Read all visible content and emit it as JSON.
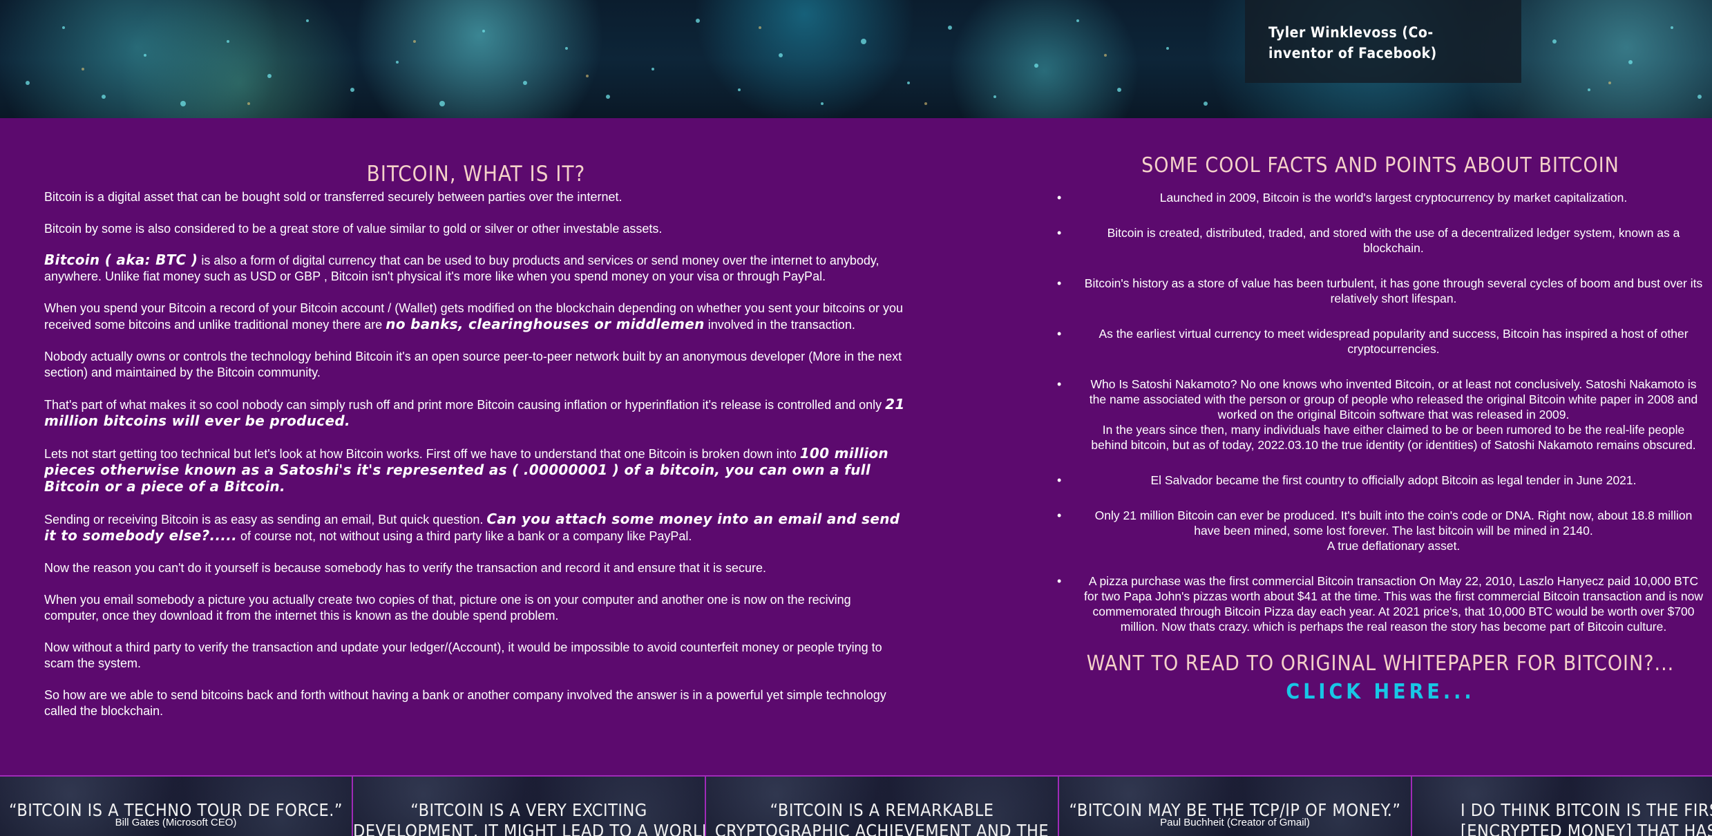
{
  "hero": {
    "quote_author": "Tyler Winklevoss (Co-inventor of Facebook)"
  },
  "left": {
    "title": "BITCOIN, WHAT IS IT?",
    "p1": "Bitcoin is a digital asset that can be bought sold or transferred securely between parties over the internet.",
    "p2": "Bitcoin by some is also considered to be a great store of value similar to gold or silver or other investable assets.",
    "p3_em": "Bitcoin ( aka: BTC )",
    "p3_rest": " is also a form of digital currency that can be used to buy products and services or send money over the internet to anybody, anywhere. Unlike fiat money such as USD or GBP , Bitcoin isn't physical it's more like when you spend money on your visa or through PayPal.",
    "p4_a": "When you spend your Bitcoin a record of your Bitcoin account / (Wallet) gets modified on the blockchain depending on whether you sent your bitcoins or you received some bitcoins and unlike traditional money there are ",
    "p4_em": "no banks, clearinghouses or middlemen",
    "p4_b": " involved in the transaction.",
    "p5": "Nobody actually owns or controls the technology behind Bitcoin it's an open source peer-to-peer network built by an anonymous developer (More in the next section) and maintained by the Bitcoin community.",
    "p6_a": "That's part of what makes it so cool nobody can simply rush off and print more Bitcoin causing inflation or hyperinflation it's release is controlled and only ",
    "p6_em": "21 million bitcoins will ever be produced.",
    "p7_a": "Lets not start getting too technical but let's look at how Bitcoin works. First off we have to understand that one Bitcoin is broken down into ",
    "p7_em": "100 million pieces otherwise known as a Satoshi's it's represented as ( .00000001 ) of a bitcoin, you can own a full Bitcoin or a piece of a Bitcoin.",
    "p8_a": "Sending or receiving Bitcoin is as easy as sending an email, But quick question. ",
    "p8_em": "Can you attach some money into an email and send it to somebody else?.....",
    "p8_b": " of course not, not without using a third party like a bank or a company like PayPal.",
    "p9": "Now the reason you can't do it yourself is because somebody has to verify the transaction and record it and ensure that it is secure.",
    "p10": "When you email somebody a picture you actually create two copies of that, picture one is on your computer and another one is now on the reciving computer, once they download it from the internet this is known as the double spend problem.",
    "p11": "Now without a third party to verify the transaction and update your ledger/(Account), it would be impossible to avoid counterfeit money or people trying to scam the system.",
    "p12": "So how are we able to send bitcoins back and forth without having a bank or another company involved the answer is in a powerful yet simple technology called the blockchain."
  },
  "right": {
    "title": "SOME COOL FACTS AND POINTS ABOUT BITCOIN",
    "facts": [
      "Launched in 2009, Bitcoin is the world's largest cryptocurrency by market capitalization.",
      "Bitcoin is created, distributed, traded, and stored with the use of a decentralized ledger system, known as a blockchain.",
      "Bitcoin's history as a store of value has been turbulent, it has gone through several cycles of boom and bust over its relatively short lifespan.",
      "As the earliest virtual currency to meet widespread popularity and success, Bitcoin has inspired a host of other cryptocurrencies.",
      "Who Is Satoshi Nakamoto? No one knows who invented Bitcoin, or at least not conclusively. Satoshi Nakamoto is the name associated with the person or group of people who released the original Bitcoin white paper in 2008 and worked on the original Bitcoin software that was released in 2009.",
      "In the years since then, many individuals have either claimed to be or been rumored to be the real-life people behind bitcoin, but as of today, 2022.03.10 the true identity (or identities) of Satoshi Nakamoto remains obscured.",
      "El Salvador became the first country to officially adopt Bitcoin as legal tender in June 2021.",
      "Only 21 million Bitcoin can ever be produced. It's built into the coin's code or DNA. Right now, about 18.8 million have been mined, some lost forever. The last bitcoin will be mined in 2140.",
      "A true deflationary asset.",
      "A pizza purchase was the first commercial Bitcoin transaction On May 22, 2010, Laszlo Hanyecz paid 10,000 BTC for two Papa John's pizzas worth about $41 at the time. This was the first commercial Bitcoin transaction and is now commemorated through Bitcoin Pizza day each year. At 2021 price's, that 10,000 BTC would be worth over $700 million. Now thats crazy. which is perhaps the real reason the story has become part of Bitcoin culture."
    ],
    "whitepaper_title": "WANT TO READ TO ORIGINAL WHITEPAPER FOR BITCOIN?...",
    "click_here": "CLICK HERE..."
  },
  "quotes": [
    {
      "text": "“BITCOIN IS A TECHNO TOUR DE FORCE.”",
      "by": "Bill Gates (Microsoft CEO)"
    },
    {
      "text": "“BITCOIN IS A VERY EXCITING",
      "by": "DEVELOPMENT, IT MIGHT LEAD TO A WORLD"
    },
    {
      "text": "“BITCOIN IS A REMARKABLE",
      "by": "CRYPTOGRAPHIC ACHIEVEMENT AND THE"
    },
    {
      "text": "“BITCOIN MAY BE THE TCP/IP OF MONEY.”",
      "by": "Paul Buchheit (Creator of Gmail)"
    },
    {
      "text": "I DO THINK BITCOIN IS THE FIRST",
      "by": "[ENCRYPTED MONEY] THAT HAS TH"
    }
  ],
  "colors": {
    "background": "#5c0a6e",
    "title": "#f4d1c9",
    "link": "#18c7e6",
    "divider": "#a02ab8"
  }
}
